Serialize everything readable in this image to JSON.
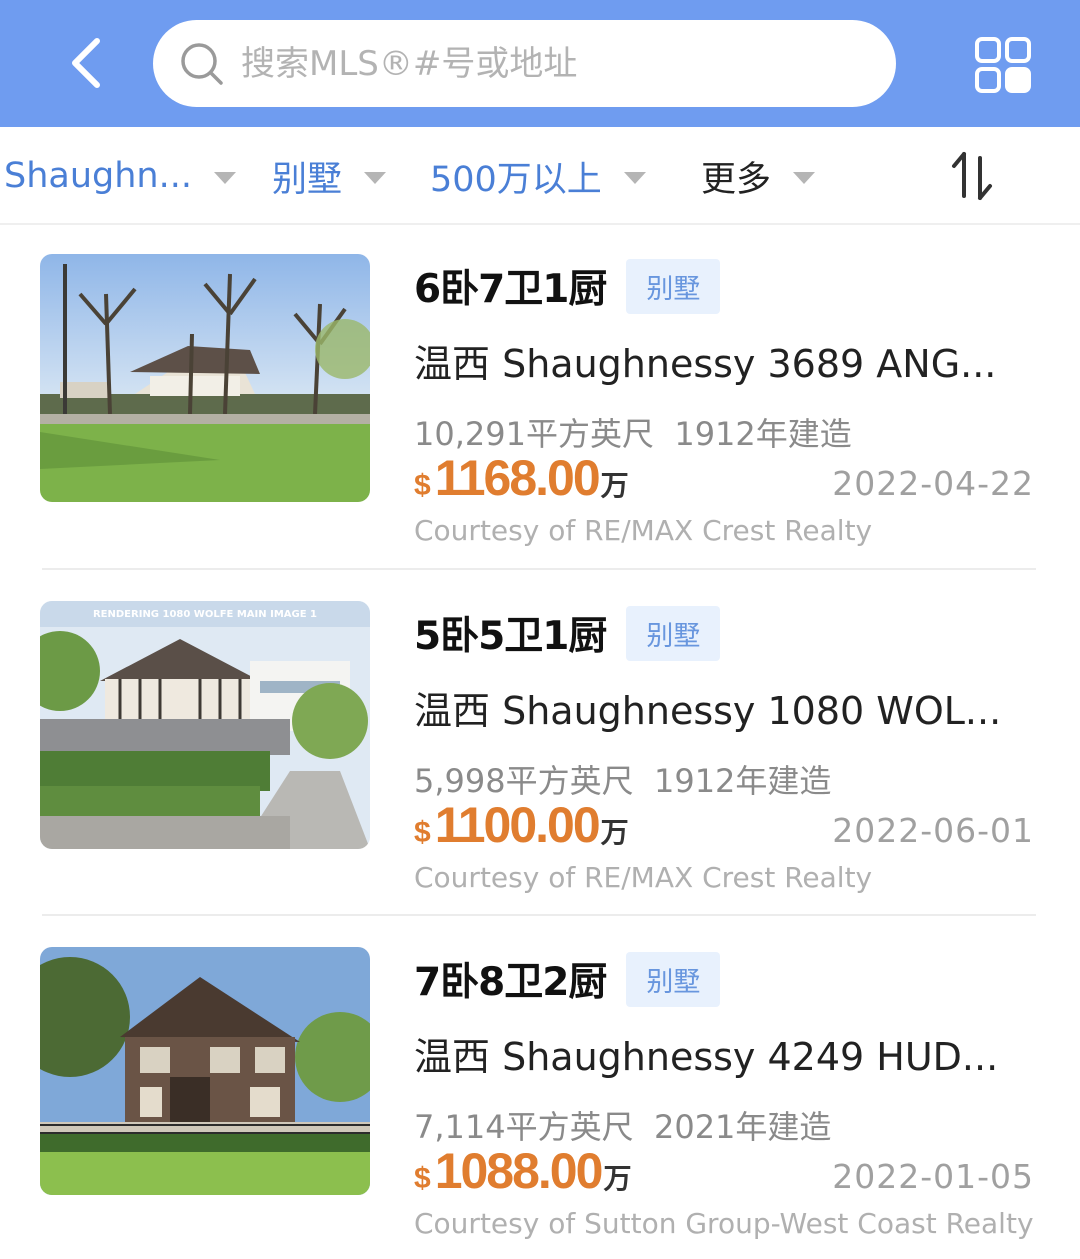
{
  "search": {
    "placeholder": "搜索MLS®#号或地址"
  },
  "filters": {
    "area": "Shaughn...",
    "type": "别墅",
    "price": "500万以上",
    "more": "更多"
  },
  "listings": [
    {
      "rooms": "6卧7卫1厨",
      "type_badge": "别墅",
      "address": "温西 Shaughnessy  3689 ANG...",
      "area": "10,291平方英尺",
      "built": "1912年建造",
      "currency": "$",
      "price": "1168.00",
      "price_unit": "万",
      "date": "2022-04-22",
      "courtesy": "Courtesy of RE/MAX Crest Realty"
    },
    {
      "rooms": "5卧5卫1厨",
      "type_badge": "别墅",
      "address": "温西 Shaughnessy  1080 WOL...",
      "area": "5,998平方英尺",
      "built": "1912年建造",
      "currency": "$",
      "price": "1100.00",
      "price_unit": "万",
      "date": "2022-06-01",
      "courtesy": "Courtesy of RE/MAX Crest Realty",
      "image_caption": "RENDERING 1080 WOLFE MAIN IMAGE 1"
    },
    {
      "rooms": "7卧8卫2厨",
      "type_badge": "别墅",
      "address": "温西 Shaughnessy  4249 HUD...",
      "area": "7,114平方英尺",
      "built": "2021年建造",
      "currency": "$",
      "price": "1088.00",
      "price_unit": "万",
      "date": "2022-01-05",
      "courtesy": "Courtesy of Sutton Group-West Coast Realty"
    }
  ],
  "colors": {
    "header": "#6f9cf0",
    "accent_blue": "#4a7fd6",
    "price": "#e07d2f",
    "badge_bg": "#e8f1fd"
  },
  "icons": {
    "back": "chevron-left-icon",
    "search": "search-icon",
    "grid": "grid-view-icon",
    "sort": "sort-icon"
  }
}
